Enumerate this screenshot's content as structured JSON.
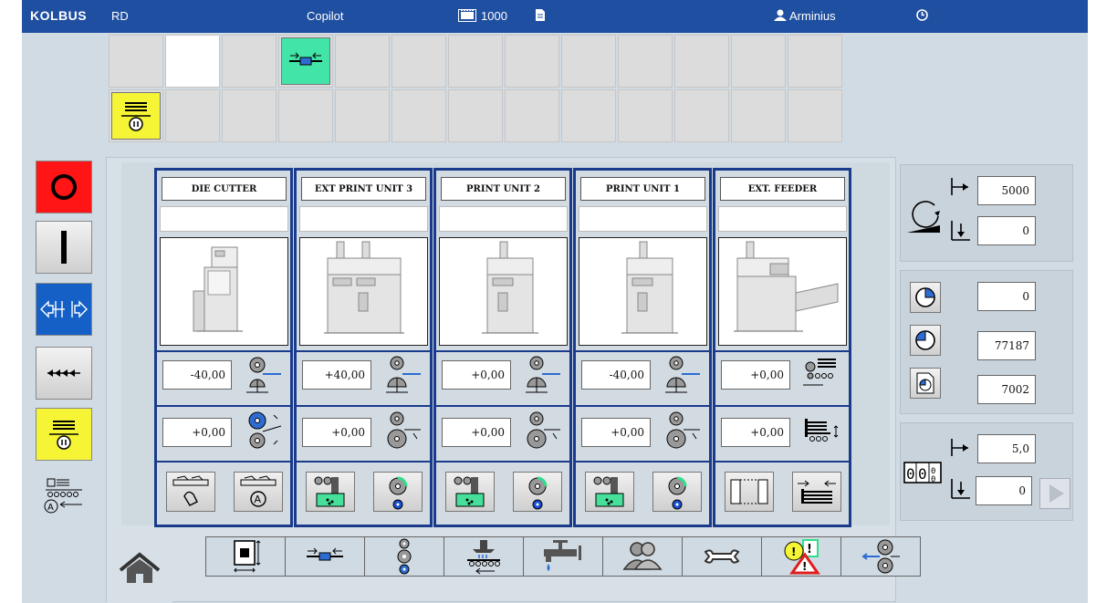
{
  "topbar": {
    "brand": "KOLBUS",
    "rd": "RD",
    "copilot": "Copilot",
    "counter": "1000",
    "user": "Arminius",
    "icons": [
      "film-strip-icon",
      "document-icon",
      "user-icon",
      "clock-icon"
    ]
  },
  "favorites": {
    "icons": [
      "shaft-coupling-icon",
      "stack-pause-icon"
    ],
    "colors": {
      "green": "#42e5a7",
      "yellow": "#f5f536"
    }
  },
  "left_controls": [
    "stop-button",
    "start-button",
    "inch-button",
    "crawl-button",
    "stack-pause-button",
    "feeder-auto-button"
  ],
  "units": [
    {
      "title": "DIE CUTTER",
      "offset1": "-40,00",
      "offset2": "+0,00",
      "buttons": [
        "manual-mode-button",
        "auto-mode-button"
      ]
    },
    {
      "title": "EXT PRINT UNIT 3",
      "offset1": "+40,00",
      "offset2": "+0,00",
      "buttons": [
        "ink-pump-button",
        "anilox-roll-button"
      ]
    },
    {
      "title": "PRINT UNIT 2",
      "offset1": "+0,00",
      "offset2": "+0,00",
      "buttons": [
        "ink-pump-button",
        "anilox-roll-button"
      ]
    },
    {
      "title": "PRINT UNIT 1",
      "offset1": "-40,00",
      "offset2": "+0,00",
      "buttons": [
        "ink-pump-button",
        "anilox-roll-button"
      ]
    },
    {
      "title": "EXT. FEEDER",
      "offset1": "+0,00",
      "offset2": "+0,00",
      "buttons": [
        "side-guides-button",
        "sheet-align-button"
      ]
    }
  ],
  "speed": {
    "set": "5000",
    "actual": "0"
  },
  "counters": {
    "c1": "0",
    "c2": "77187",
    "c3": "7002"
  },
  "batch": {
    "set": "5,0",
    "actual": "0"
  },
  "bottom_bar": [
    "format-icon",
    "shaft-coupling-icon",
    "rollers-icon",
    "feeder-icon",
    "ink-tap-icon",
    "users-icon",
    "wrench-icon",
    "warning-icon",
    "roll-adjust-icon"
  ]
}
